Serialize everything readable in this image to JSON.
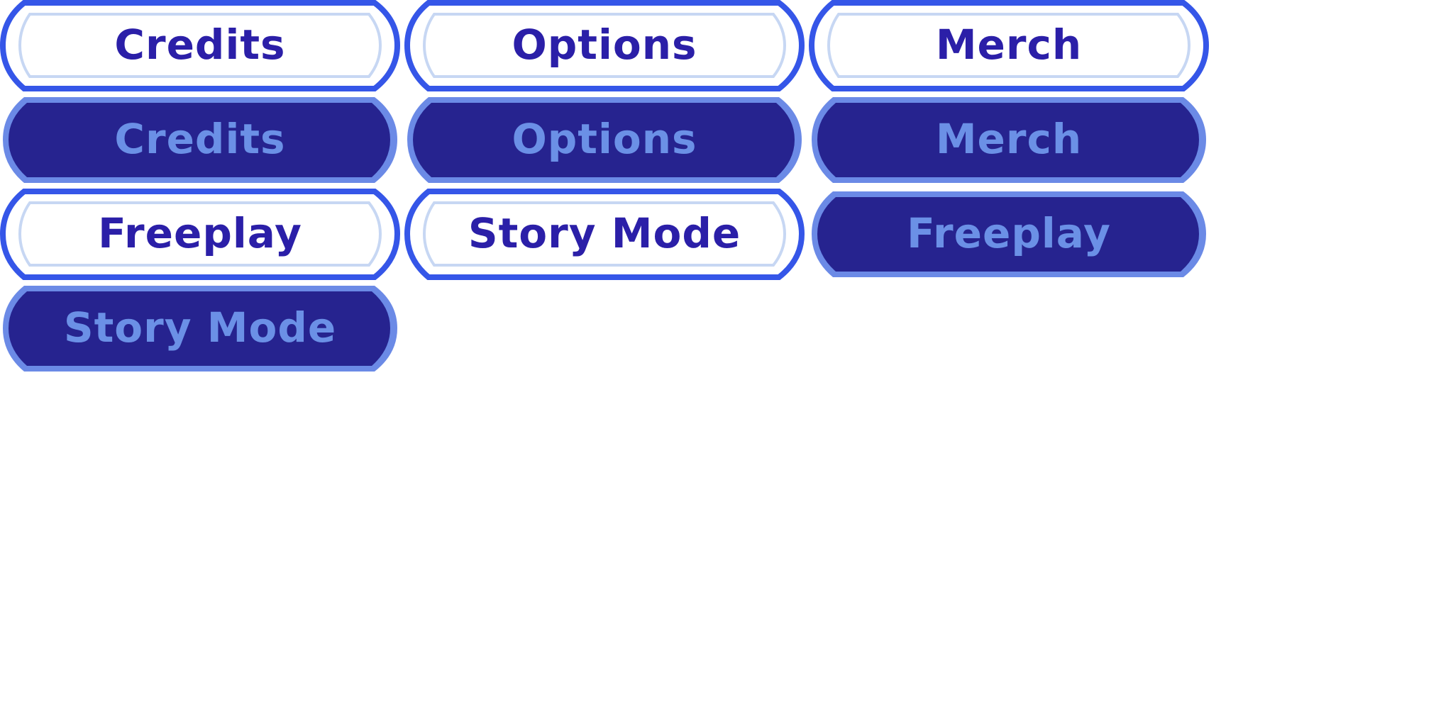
{
  "colors": {
    "idle_outline": "#3556e8",
    "idle_fill": "#ffffff",
    "idle_inner_line": "#c7d7f3",
    "idle_text": "#2b1fa8",
    "selected_outline": "#6b8ae6",
    "selected_fill": "#26238f",
    "selected_text": "#6b90e6"
  },
  "buttons": {
    "credits_idle": {
      "label": "Credits",
      "state": "idle"
    },
    "options_idle": {
      "label": "Options",
      "state": "idle"
    },
    "merch_idle": {
      "label": "Merch",
      "state": "idle"
    },
    "credits_selected": {
      "label": "Credits",
      "state": "selected"
    },
    "options_selected": {
      "label": "Options",
      "state": "selected"
    },
    "merch_selected": {
      "label": "Merch",
      "state": "selected"
    },
    "freeplay_idle": {
      "label": "Freeplay",
      "state": "idle"
    },
    "storymode_idle": {
      "label": "Story Mode",
      "state": "idle"
    },
    "freeplay_selected": {
      "label": "Freeplay",
      "state": "selected"
    },
    "storymode_selected": {
      "label": "Story Mode",
      "state": "selected"
    }
  }
}
